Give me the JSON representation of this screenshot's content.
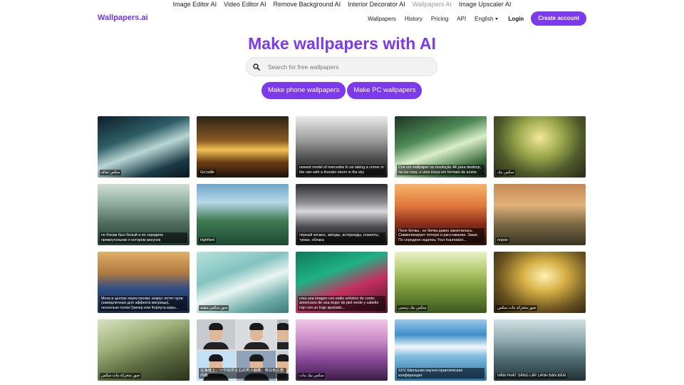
{
  "topbar": {
    "links": [
      {
        "label": "Image Editor AI",
        "active": false
      },
      {
        "label": "Video Editor AI",
        "active": false
      },
      {
        "label": "Remove Background AI",
        "active": false
      },
      {
        "label": "Interior Decorator AI",
        "active": false
      },
      {
        "label": "Wallpapers AI",
        "active": true
      },
      {
        "label": "Image Upscaler AI",
        "active": false
      }
    ]
  },
  "header": {
    "logo": "Wallpapers.ai",
    "nav": [
      "Wallpapers",
      "History",
      "Pricing",
      "API"
    ],
    "language": "English",
    "login": "Login",
    "create_account": "Create account"
  },
  "hero": {
    "title": "Make wallpapers with AI",
    "search_placeholder": "Search for free wallpapers",
    "phone_button": "Make phone wallpapers",
    "pc_button": "Make PC wallpapers"
  },
  "colors": {
    "brand": "#7c3aed",
    "logo": "#6d35e6"
  },
  "gallery": [
    {
      "caption": "سكس ثماله",
      "style": "linear-gradient(160deg,#0d1f2b 0%,#2e5d66 35%,#b9d6d4 55%,#1b3a46 80%,#0a1820 100%)"
    },
    {
      "caption": "Go'zallik",
      "style": "linear-gradient(180deg,#2a2418 0%,#8a5a22 40%,#f2c255 55%,#6b3c14 75%,#1c140b 100%)"
    },
    {
      "caption": "newest model of mercedes tt car taking a corner in the rain with a thunder storm in the sky",
      "style": "linear-gradient(180deg,#e9e9e9 0%,#9a9a9a 40%,#4a4a4a 70%,#1b1b1b 100%)"
    },
    {
      "caption": "Crie um wallpaper na resolução 4K para desktop, na cor roxa, e uma moça em formato de anime",
      "style": "linear-gradient(160deg,#1d3524 0%,#4e8a56 35%,#d8eec9 55%,#3f6d40 80%,#14261a 100%)"
    },
    {
      "caption": "سكس نيك",
      "style": "radial-gradient(ellipse at 50% 35%,#f4e79a 0%,#9aa64a 35%,#4e5a2a 65%,#2a2718 100%)"
    },
    {
      "caption": "по бокам был белый а по середине прямоугольник п котором рисунок",
      "style": "linear-gradient(180deg,#cfe0d8 0%,#8aa79a 35%,#4c6b5d 65%,#233a31 100%)"
    },
    {
      "caption": "highfleet",
      "style": "linear-gradient(180deg,#6fa6c9 0%,#b8d8e8 30%,#3f7a52 60%,#1e4a34 100%)"
    },
    {
      "caption": "чёрный космос, звёзды, астероиды, планеты, туман, облака",
      "style": "linear-gradient(180deg,#2b2b2f 0%,#8c8c90 30%,#d7d7da 45%,#4b4b4f 70%,#151517 100%)"
    },
    {
      "caption": "Поле битвы , но битва давно закончилась. Символизирует потерю и расставание. Закат. По середине надпись Your traumatize...",
      "style": "linear-gradient(180deg,#f6b46a 0%,#e07a3c 35%,#8d2e1b 65%,#2c110b 100%)"
    },
    {
      "caption": "порно",
      "style": "linear-gradient(180deg,#c48a56 0%,#e2b07a 35%,#7c6a44 65%,#3a3323 100%)"
    },
    {
      "caption": "Mesa в центре перестрелки: вокруг летят пули (замедленные для эффекта матрицы), несколько голов Гринер или Корпуса взры...",
      "style": "linear-gradient(180deg,#e0b06a 0%,#b07840 35%,#2f4f86 60%,#1a2a4a 100%)"
    },
    {
      "caption": "صور سكس منقبه",
      "style": "linear-gradient(160deg,#b6e2dc 0%,#82c3c0 35%,#e9f5f1 55%,#6aa9a6 80%,#3e7c7a 100%)"
    },
    {
      "caption": "crea una imagen con estilo artístico de comic americano de una mujer de piel verde y cabello rojo con un traje ajustado...",
      "style": "linear-gradient(160deg,#0e7a58 0%,#1fb184 35%,#c43060 60%,#4a1328 100%)"
    },
    {
      "caption": "سكس نيك رسمى",
      "style": "linear-gradient(180deg,#e8f1c4 0%,#b9cc72 30%,#7a9a3a 60%,#3c5720 100%)"
    },
    {
      "caption": "صور متحركه بنات سكس",
      "style": "radial-gradient(ellipse at 55% 40%,#fff1b4 0%,#d6b044 30%,#6b5420 65%,#241b0c 100%)"
    },
    {
      "caption": "صور متحركة بنات سكس",
      "style": "linear-gradient(160deg,#d9e2c0 0%,#9fb07a 35%,#5c6a40 65%,#2a301c 100%)"
    },
    {
      "caption": "在海滩上，一个60岁左右的男人躺着，穿白色三角内裤",
      "style": "#dddddd",
      "faces": true
    },
    {
      "caption": "سكس نيك بنات",
      "style": "linear-gradient(180deg,#f0c6e6 0%,#c98ac6 35%,#8a4a9a 65%,#3a1c44 100%)"
    },
    {
      "caption": "XXV Школьная научно-практическая конференция",
      "style": "linear-gradient(180deg,#9cc8e8 0%,#3d8fc9 25%,#f3f8fb 45%,#7fbde0 60%,#2a6f9e 100%)"
    },
    {
      "caption": "NĂM PHÁT SÁNG LẬP LÀNH BẠN ĐÊM",
      "style": "linear-gradient(180deg,#d2e0e4 0%,#8fa9af 35%,#4f6b70 65%,#223236 100%)"
    }
  ]
}
